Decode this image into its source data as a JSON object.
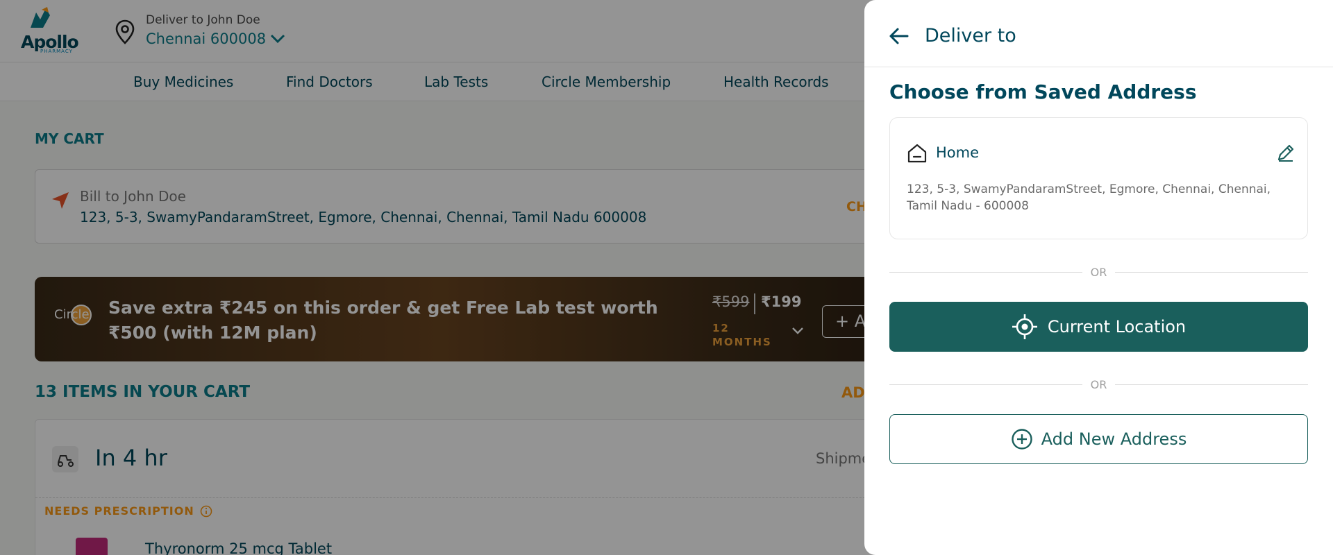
{
  "header": {
    "brand": "Apollo",
    "brand_sub": "PHARMACY",
    "deliver_label": "Deliver to John Doe",
    "deliver_city": "Chennai 600008"
  },
  "nav": {
    "items": [
      "Buy Medicines",
      "Find Doctors",
      "Lab Tests",
      "Circle Membership",
      "Health Records"
    ]
  },
  "cart": {
    "title": "MY CART",
    "bill_label": "Bill to John Doe",
    "bill_address": "123, 5-3, SwamyPandaramStreet, Egmore, Chennai, Chennai, Tamil Nadu 600008",
    "change_label": "CH",
    "circle_logo": "Circle",
    "circle_text": "Save extra ₹245 on this order & get Free Lab test worth ₹500 (with 12M plan)",
    "price_old": "₹599",
    "price_new": "₹199",
    "price_months": "12 MONTHS",
    "add_label": "+  A",
    "items_title": "13 ITEMS IN YOUR CART",
    "items_add": "ADI",
    "ship_title": "In 4 hr",
    "ship_right": "Shipme",
    "rx_label": "NEEDS PRESCRIPTION",
    "medicine_name": "Thyronorm 25 mcg Tablet"
  },
  "panel": {
    "title": "Deliver to",
    "saved_title": "Choose from Saved Address",
    "saved_address": {
      "label": "Home",
      "address": "123, 5-3, SwamyPandaramStreet, Egmore, Chennai, Chennai, Tamil Nadu - 600008"
    },
    "or_text": "OR",
    "current_location_label": "Current Location",
    "add_new_label": "Add New Address"
  },
  "colors": {
    "primary_dark": "#01475b",
    "teal_button": "#1a5f5c",
    "accent_orange": "#fc9916",
    "link_teal": "#0c7d8a"
  },
  "icons": [
    "apollo-logo-icon",
    "location-pin-icon",
    "chevron-down-icon",
    "send-icon",
    "scooter-icon",
    "info-icon",
    "back-arrow-icon",
    "home-icon",
    "edit-pencil-icon",
    "crosshair-icon",
    "plus-circle-icon"
  ]
}
